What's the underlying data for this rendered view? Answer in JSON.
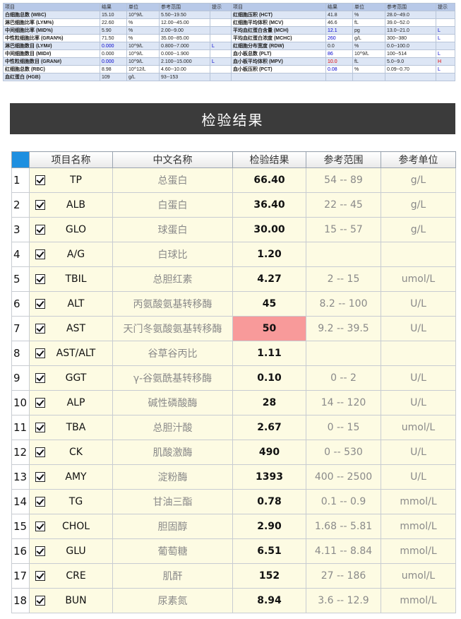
{
  "cbc": {
    "headers": [
      "项目",
      "结果",
      "单位",
      "参考范围",
      "提示",
      "项目",
      "结果",
      "单位",
      "参考范围",
      "提示"
    ],
    "rows": [
      {
        "l_name": "白细胞总数 (WBC)",
        "l_val": "15.10",
        "l_unit": "10^9/L",
        "l_ref": "5.50--19.50",
        "l_flag": "",
        "r_name": "红细胞压积 (HCT)",
        "r_val": "41.8",
        "r_unit": "%",
        "r_ref": "28.0--49.0",
        "r_flag": ""
      },
      {
        "l_name": "淋巴细胞比率 (LYM%)",
        "l_val": "22.60",
        "l_unit": "%",
        "l_ref": "12.00--45.00",
        "l_flag": "",
        "r_name": "红细胞平均体积 (MCV)",
        "r_val": "46.6",
        "r_unit": "fL",
        "r_ref": "39.0--52.0",
        "r_flag": ""
      },
      {
        "l_name": "中间细胞比率 (MID%)",
        "l_val": "5.90",
        "l_unit": "%",
        "l_ref": "2.00--9.00",
        "l_flag": "",
        "r_name": "平均血红蛋白含量 (MCH)",
        "r_val": "12.1",
        "r_unit": "pg",
        "r_ref": "13.0--21.0",
        "r_flag": "L"
      },
      {
        "l_name": "中性粒细胞比率 (GRAN%)",
        "l_val": "71.50",
        "l_unit": "%",
        "l_ref": "35.00--85.00",
        "l_flag": "",
        "r_name": "平均血红蛋白浓度 (MCHC)",
        "r_val": "260",
        "r_unit": "g/L",
        "r_ref": "300--380",
        "r_flag": "L"
      },
      {
        "l_name": "淋巴细胞数目 (LYM#)",
        "l_val": "0.000",
        "l_unit": "10^9/L",
        "l_ref": "0.800--7.000",
        "l_flag": "L",
        "r_name": "红细胞分布宽度 (RDW)",
        "r_val": "0.0",
        "r_unit": "%",
        "r_ref": "0.0--100.0",
        "r_flag": ""
      },
      {
        "l_name": "中间细胞数目 (MID#)",
        "l_val": "0.000",
        "l_unit": "10^9/L",
        "l_ref": "0.000--1.900",
        "l_flag": "",
        "r_name": "血小板总数 (PLT)",
        "r_val": "86",
        "r_unit": "10^9/L",
        "r_ref": "100--514",
        "r_flag": "L"
      },
      {
        "l_name": "中性粒细胞数目 (GRAN#)",
        "l_val": "0.000",
        "l_unit": "10^9/L",
        "l_ref": "2.100--15.000",
        "l_flag": "L",
        "r_name": "血小板平均体积 (MPV)",
        "r_val": "10.0",
        "r_unit": "fL",
        "r_ref": "5.0--9.0",
        "r_flag": "H"
      },
      {
        "l_name": "红细胞总数 (RBC)",
        "l_val": "8.98",
        "l_unit": "10^12/L",
        "l_ref": "4.60--10.00",
        "l_flag": "",
        "r_name": "血小板压积 (PCT)",
        "r_val": "0.08",
        "r_unit": "%",
        "r_ref": "0.09--0.70",
        "r_flag": "L"
      },
      {
        "l_name": "血红蛋白 (HGB)",
        "l_val": "109",
        "l_unit": "g/L",
        "l_ref": "93--153",
        "l_flag": "",
        "r_name": "",
        "r_val": "",
        "r_unit": "",
        "r_ref": "",
        "r_flag": ""
      }
    ]
  },
  "panel": {
    "title": "检验结果"
  },
  "table": {
    "headers": {
      "code": "项目名称",
      "cname": "中文名称",
      "result": "检验结果",
      "range": "参考范围",
      "unit": "参考单位"
    },
    "rows": [
      {
        "idx": "1",
        "code": "TP",
        "cname": "总蛋白",
        "result": "66.40",
        "range": "54 -- 89",
        "unit": "g/L",
        "high": false
      },
      {
        "idx": "2",
        "code": "ALB",
        "cname": "白蛋白",
        "result": "36.40",
        "range": "22 -- 45",
        "unit": "g/L",
        "high": false
      },
      {
        "idx": "3",
        "code": "GLO",
        "cname": "球蛋白",
        "result": "30.00",
        "range": "15 -- 57",
        "unit": "g/L",
        "high": false
      },
      {
        "idx": "4",
        "code": "A/G",
        "cname": "白球比",
        "result": "1.20",
        "range": "",
        "unit": "",
        "high": false
      },
      {
        "idx": "5",
        "code": "TBIL",
        "cname": "总胆红素",
        "result": "4.27",
        "range": "2 -- 15",
        "unit": "umol/L",
        "high": false
      },
      {
        "idx": "6",
        "code": "ALT",
        "cname": "丙氨酸氨基转移酶",
        "result": "45",
        "range": "8.2 -- 100",
        "unit": "U/L",
        "high": false
      },
      {
        "idx": "7",
        "code": "AST",
        "cname": "天门冬氨酸氨基转移酶",
        "result": "50",
        "range": "9.2 -- 39.5",
        "unit": "U/L",
        "high": true
      },
      {
        "idx": "8",
        "code": "AST/ALT",
        "cname": "谷草谷丙比",
        "result": "1.11",
        "range": "",
        "unit": "",
        "high": false
      },
      {
        "idx": "9",
        "code": "GGT",
        "cname": "γ-谷氨酰基转移酶",
        "result": "0.10",
        "range": "0 -- 2",
        "unit": "U/L",
        "high": false
      },
      {
        "idx": "10",
        "code": "ALP",
        "cname": "碱性磷酸酶",
        "result": "28",
        "range": "14 -- 120",
        "unit": "U/L",
        "high": false
      },
      {
        "idx": "11",
        "code": "TBA",
        "cname": "总胆汁酸",
        "result": "2.67",
        "range": "0 -- 15",
        "unit": "umol/L",
        "high": false
      },
      {
        "idx": "12",
        "code": "CK",
        "cname": "肌酸激酶",
        "result": "490",
        "range": "0 -- 530",
        "unit": "U/L",
        "high": false
      },
      {
        "idx": "13",
        "code": "AMY",
        "cname": "淀粉酶",
        "result": "1393",
        "range": "400 -- 2500",
        "unit": "U/L",
        "high": false
      },
      {
        "idx": "14",
        "code": "TG",
        "cname": "甘油三酯",
        "result": "0.78",
        "range": "0.1 -- 0.9",
        "unit": "mmol/L",
        "high": false
      },
      {
        "idx": "15",
        "code": "CHOL",
        "cname": "胆固醇",
        "result": "2.90",
        "range": "1.68 -- 5.81",
        "unit": "mmol/L",
        "high": false
      },
      {
        "idx": "16",
        "code": "GLU",
        "cname": "葡萄糖",
        "result": "6.51",
        "range": "4.11 -- 8.84",
        "unit": "mmol/L",
        "high": false
      },
      {
        "idx": "17",
        "code": "CRE",
        "cname": "肌酐",
        "result": "152",
        "range": "27 -- 186",
        "unit": "umol/L",
        "high": false
      },
      {
        "idx": "18",
        "code": "BUN",
        "cname": "尿素氮",
        "result": "8.94",
        "range": "3.6 -- 12.9",
        "unit": "mmol/L",
        "high": false
      }
    ]
  },
  "colors": {
    "header_bar": "#3b3b3b",
    "row_background": "#fdfbe3",
    "high_flag": "#f89a9a",
    "corner_cell": "#1e8fe0",
    "low_flag_text": "#0000cc",
    "high_flag_text": "#e00000"
  },
  "icons": {
    "row_checkbox": "checkbox-checked-icon"
  }
}
